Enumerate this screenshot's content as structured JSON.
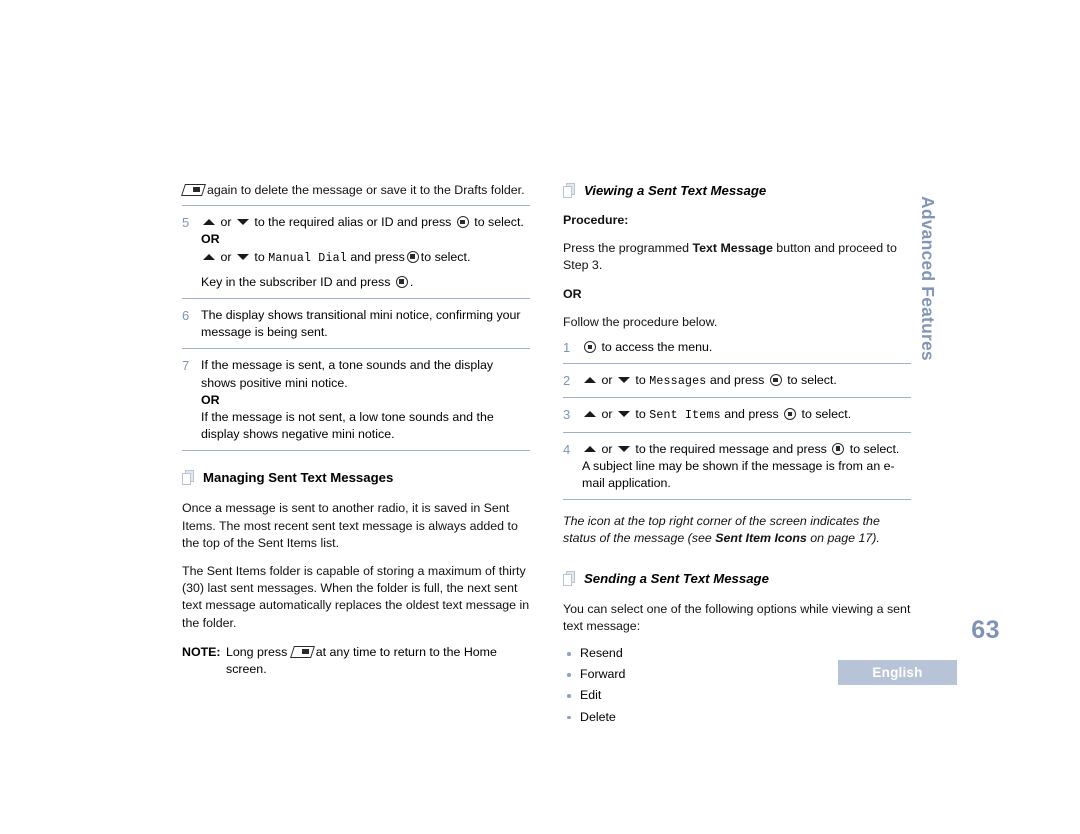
{
  "document": {
    "page_number": "63",
    "language_badge": "English",
    "side_tab": "Advanced Features"
  },
  "icons": {
    "pages": "pages-stack-icon",
    "menu_key": "menu-button-icon",
    "back_key": "back-button-icon",
    "arrow_up": "arrow-up-icon",
    "arrow_down": "arrow-down-icon"
  },
  "left_column": {
    "lead_in": {
      "prefix": "",
      "text_after_icon": "again to delete the message or save it to the Drafts folder."
    },
    "steps": [
      {
        "num": "5",
        "line1_pre": "or",
        "line1_mid": "to the required alias or ID and press",
        "line1_post": "to select.",
        "or_label": "OR",
        "line2_pre": "or",
        "line2_mid": "to",
        "line2_mono": "Manual Dial",
        "line2_mid2": "and press",
        "line2_post": "to select.",
        "line3_pre": "Key in the subscriber ID and press",
        "line3_post": "."
      },
      {
        "num": "6",
        "text": "The display shows transitional mini notice, confirming your message is being sent."
      },
      {
        "num": "7",
        "line1": "If the message is sent, a tone sounds and the display shows positive mini notice.",
        "or_label": "OR",
        "line2": "If the message is not sent, a low tone sounds and the display shows negative mini notice."
      }
    ],
    "heading": "Managing Sent Text Messages",
    "paragraphs": [
      "Once a message is sent to another radio, it is saved in Sent Items. The most recent sent text message is always added to the top of the Sent Items list.",
      "The Sent Items folder is capable of storing a maximum of thirty (30) last sent messages. When the folder is full, the next sent text message automatically replaces the oldest text message in the folder."
    ],
    "note": {
      "label": "NOTE:",
      "text_before_icon": "Long press",
      "text_after_icon": "at any time to return to the Home screen."
    }
  },
  "right_column": {
    "heading_viewing": "Viewing a Sent Text Message",
    "procedure_label": "Procedure:",
    "procedure_pre": "Press the programmed",
    "procedure_bold": "Text Message",
    "procedure_post": "button and proceed to Step 3.",
    "or_label": "OR",
    "follow_text": "Follow the procedure below.",
    "steps": [
      {
        "num": "1",
        "text_after_icon": "to access the menu."
      },
      {
        "num": "2",
        "pre": "or",
        "mid": "to",
        "mono": "Messages",
        "mid2": "and press",
        "post": "to select."
      },
      {
        "num": "3",
        "pre": "or",
        "mid": "to",
        "mono": "Sent Items",
        "mid2": "and press",
        "post": "to select."
      },
      {
        "num": "4",
        "pre": "or",
        "mid": "to the required message and press",
        "post": "to select.",
        "extra": "A subject line may be shown if the message is from an e-mail application."
      }
    ],
    "italic_note_pre": "The icon at the top right corner of the screen indicates the status of the message (see",
    "italic_note_bold": "Sent Item Icons",
    "italic_note_post": "on page 17).",
    "heading_sending": "Sending a Sent Text Message",
    "sending_intro": "You can select one of the following options while viewing a sent text message:",
    "options": [
      "Resend",
      "Forward",
      "Edit",
      "Delete"
    ]
  },
  "colors": {
    "step_number": "#7f94b5",
    "rule": "#9fb0cc",
    "side_tab": "#8195b6",
    "badge_bg": "#b7c3d6",
    "bullet": "#8fa2bf"
  }
}
